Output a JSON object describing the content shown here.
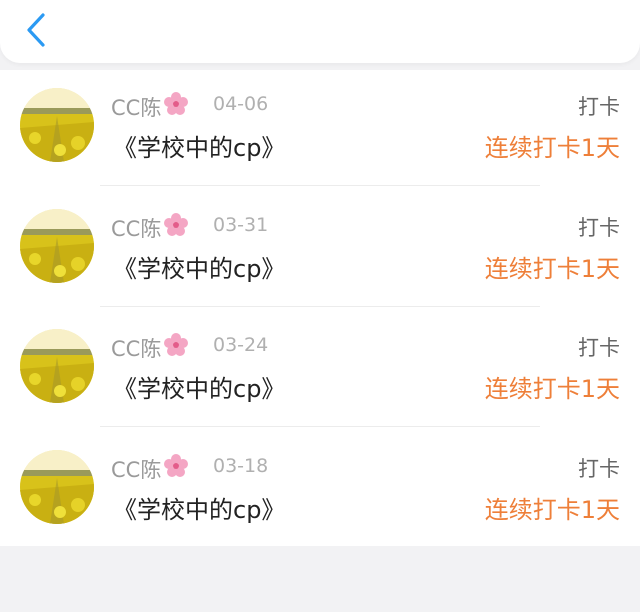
{
  "header": {
    "back_icon": "chevron-left-icon",
    "accent_color": "#2b9af3"
  },
  "entries": [
    {
      "name": "CC陈",
      "name_icon": "cherry-blossom-icon",
      "date": "04-06",
      "title": "《学校中的cp》",
      "tag": "打卡",
      "streak": "连续打卡1天"
    },
    {
      "name": "CC陈",
      "name_icon": "cherry-blossom-icon",
      "date": "03-31",
      "title": "《学校中的cp》",
      "tag": "打卡",
      "streak": "连续打卡1天"
    },
    {
      "name": "CC陈",
      "name_icon": "cherry-blossom-icon",
      "date": "03-24",
      "title": "《学校中的cp》",
      "tag": "打卡",
      "streak": "连续打卡1天"
    },
    {
      "name": "CC陈",
      "name_icon": "cherry-blossom-icon",
      "date": "03-18",
      "title": "《学校中的cp》",
      "tag": "打卡",
      "streak": "连续打卡1天"
    }
  ],
  "colors": {
    "streak": "#ee7f39",
    "name": "#9a9a9a",
    "date": "#b0b0b0",
    "title": "#222222"
  }
}
